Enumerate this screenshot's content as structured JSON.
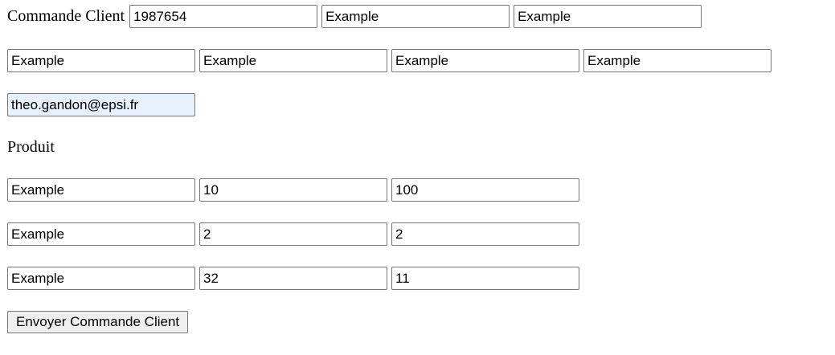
{
  "form": {
    "title": "Commande Client",
    "client_id": "1987654",
    "client_fields_row1": [
      "Example",
      "Example"
    ],
    "client_fields_row2": [
      "Example",
      "Example",
      "Example",
      "Example"
    ],
    "email": "theo.gandon@epsi.fr",
    "products_title": "Produit",
    "products": [
      {
        "name": "Example",
        "quantity": "10",
        "price": "100"
      },
      {
        "name": "Example",
        "quantity": "2",
        "price": "2"
      },
      {
        "name": "Example",
        "quantity": "32",
        "price": "11"
      }
    ],
    "submit_label": "Envoyer Commande Client"
  }
}
